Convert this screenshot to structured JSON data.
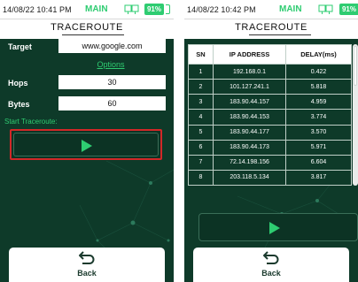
{
  "colors": {
    "accent": "#2ecc71",
    "background": "#0e3a29",
    "highlight": "#d22828"
  },
  "left": {
    "status": {
      "time": "14/08/22 10:41 PM",
      "mode": "MAIN",
      "battery": "91%"
    },
    "title": "TRACEROUTE",
    "target": {
      "label": "Target",
      "value": "www.google.com"
    },
    "options_label": "Options",
    "hops": {
      "label": "Hops",
      "value": "30"
    },
    "bytes": {
      "label": "Bytes",
      "value": "60"
    },
    "start_label": "Start Traceroute:",
    "start_icon": "play-icon",
    "back": {
      "label": "Back",
      "icon": "back-arrow-icon"
    }
  },
  "right": {
    "status": {
      "time": "14/08/22 10:42 PM",
      "mode": "MAIN",
      "battery": "91%"
    },
    "title": "TRACEROUTE",
    "table": {
      "headers": [
        "SN",
        "IP ADDRESS",
        "DELAY(ms)"
      ],
      "rows": [
        [
          "1",
          "192.168.0.1",
          "0.422"
        ],
        [
          "2",
          "101.127.241.1",
          "5.818"
        ],
        [
          "3",
          "183.90.44.157",
          "4.959"
        ],
        [
          "4",
          "183.90.44.153",
          "3.774"
        ],
        [
          "5",
          "183.90.44.177",
          "3.570"
        ],
        [
          "6",
          "183.90.44.173",
          "5.971"
        ],
        [
          "7",
          "72.14.198.156",
          "6.604"
        ],
        [
          "8",
          "203.118.5.134",
          "3.817"
        ]
      ]
    },
    "run_icon": "play-icon",
    "back": {
      "label": "Back",
      "icon": "back-arrow-icon"
    }
  }
}
